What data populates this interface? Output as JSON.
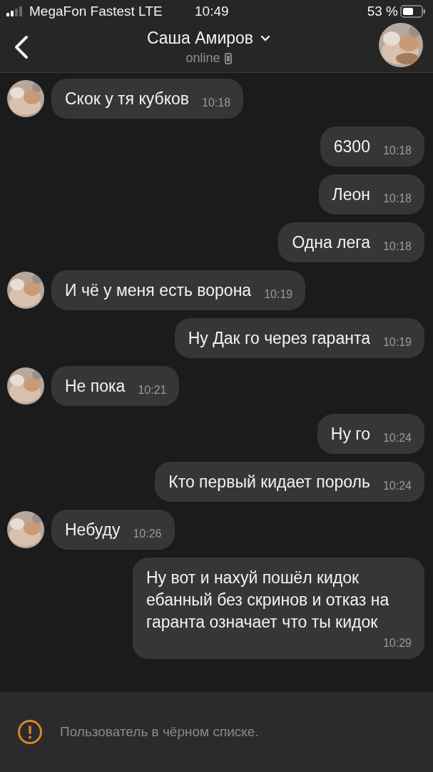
{
  "status_bar": {
    "carrier": "MegaFon Fastest LTE",
    "time": "10:49",
    "battery": "53 %"
  },
  "header": {
    "name": "Саша Амиров",
    "status": "online"
  },
  "messages": [
    {
      "kind": "incoming",
      "text": "Скок у тя кубков",
      "time": "10:18"
    },
    {
      "kind": "outgoing",
      "text": "6300",
      "time": "10:18"
    },
    {
      "kind": "outgoing",
      "text": "Леон",
      "time": "10:18"
    },
    {
      "kind": "outgoing",
      "text": "Одна лега",
      "time": "10:18"
    },
    {
      "kind": "incoming",
      "text": "И чё у меня есть ворона",
      "time": "10:19"
    },
    {
      "kind": "outgoing",
      "text": "Ну Дак го через гаранта",
      "time": "10:19"
    },
    {
      "kind": "incoming",
      "text": "Не пока",
      "time": "10:21"
    },
    {
      "kind": "outgoing",
      "text": "Ну го",
      "time": "10:24"
    },
    {
      "kind": "outgoing",
      "text": "Кто первый кидает пороль",
      "time": "10:24"
    },
    {
      "kind": "incoming",
      "text": "Небуду",
      "time": "10:26"
    },
    {
      "kind": "outgoing",
      "text": "Ну вот и нахуй пошёл кидок ебанный без скринов и отказ на гаранта означает что ты кидок",
      "time": "10:29"
    }
  ],
  "notice": "Пользователь в чёрном списке."
}
